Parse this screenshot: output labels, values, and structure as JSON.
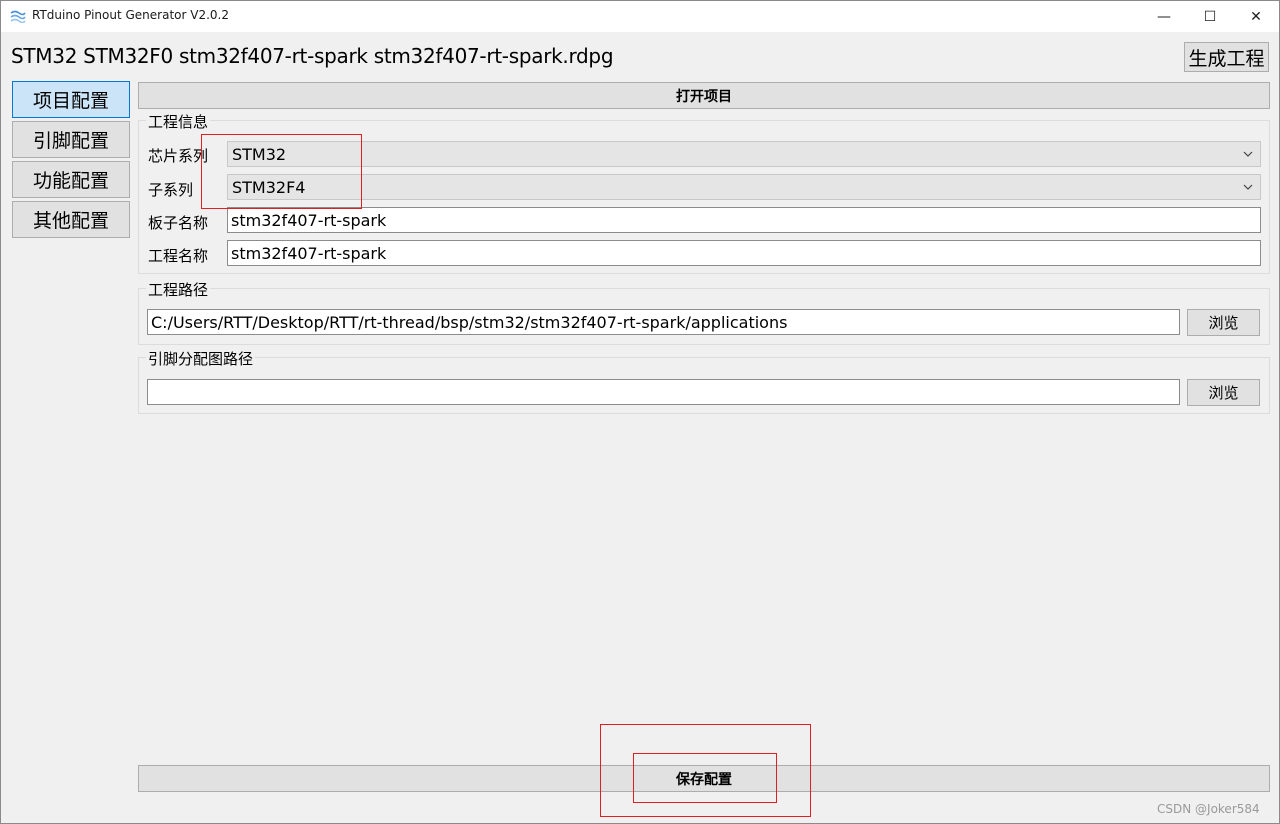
{
  "window": {
    "title": "RTduino Pinout Generator V2.0.2",
    "controls": {
      "minimize": "—",
      "maximize": "☐",
      "close": "✕"
    }
  },
  "header": {
    "project_line": "STM32 STM32F0 stm32f407-rt-spark stm32f407-rt-spark.rdpg",
    "generate_button": "生成工程"
  },
  "sidebar": {
    "items": [
      {
        "label": "项目配置",
        "active": true
      },
      {
        "label": "引脚配置",
        "active": false
      },
      {
        "label": "功能配置",
        "active": false
      },
      {
        "label": "其他配置",
        "active": false
      }
    ]
  },
  "main": {
    "open_project_button": "打开项目",
    "project_info": {
      "title": "工程信息",
      "chip_series_label": "芯片系列",
      "chip_series_value": "STM32",
      "sub_series_label": "子系列",
      "sub_series_value": "STM32F4",
      "board_name_label": "板子名称",
      "board_name_value": "stm32f407-rt-spark",
      "project_name_label": "工程名称",
      "project_name_value": "stm32f407-rt-spark"
    },
    "project_path": {
      "title": "工程路径",
      "value": "C:/Users/RTT/Desktop/RTT/rt-thread/bsp/stm32/stm32f407-rt-spark/applications",
      "browse_button": "浏览"
    },
    "pinmap_path": {
      "title": "引脚分配图路径",
      "value": "",
      "browse_button": "浏览"
    },
    "save_button": "保存配置"
  },
  "watermark": "CSDN @Joker584",
  "colors": {
    "highlight": "#e02020",
    "active_tab": "#cce4f7",
    "active_border": "#0078d7",
    "button": "#e1e1e1"
  }
}
